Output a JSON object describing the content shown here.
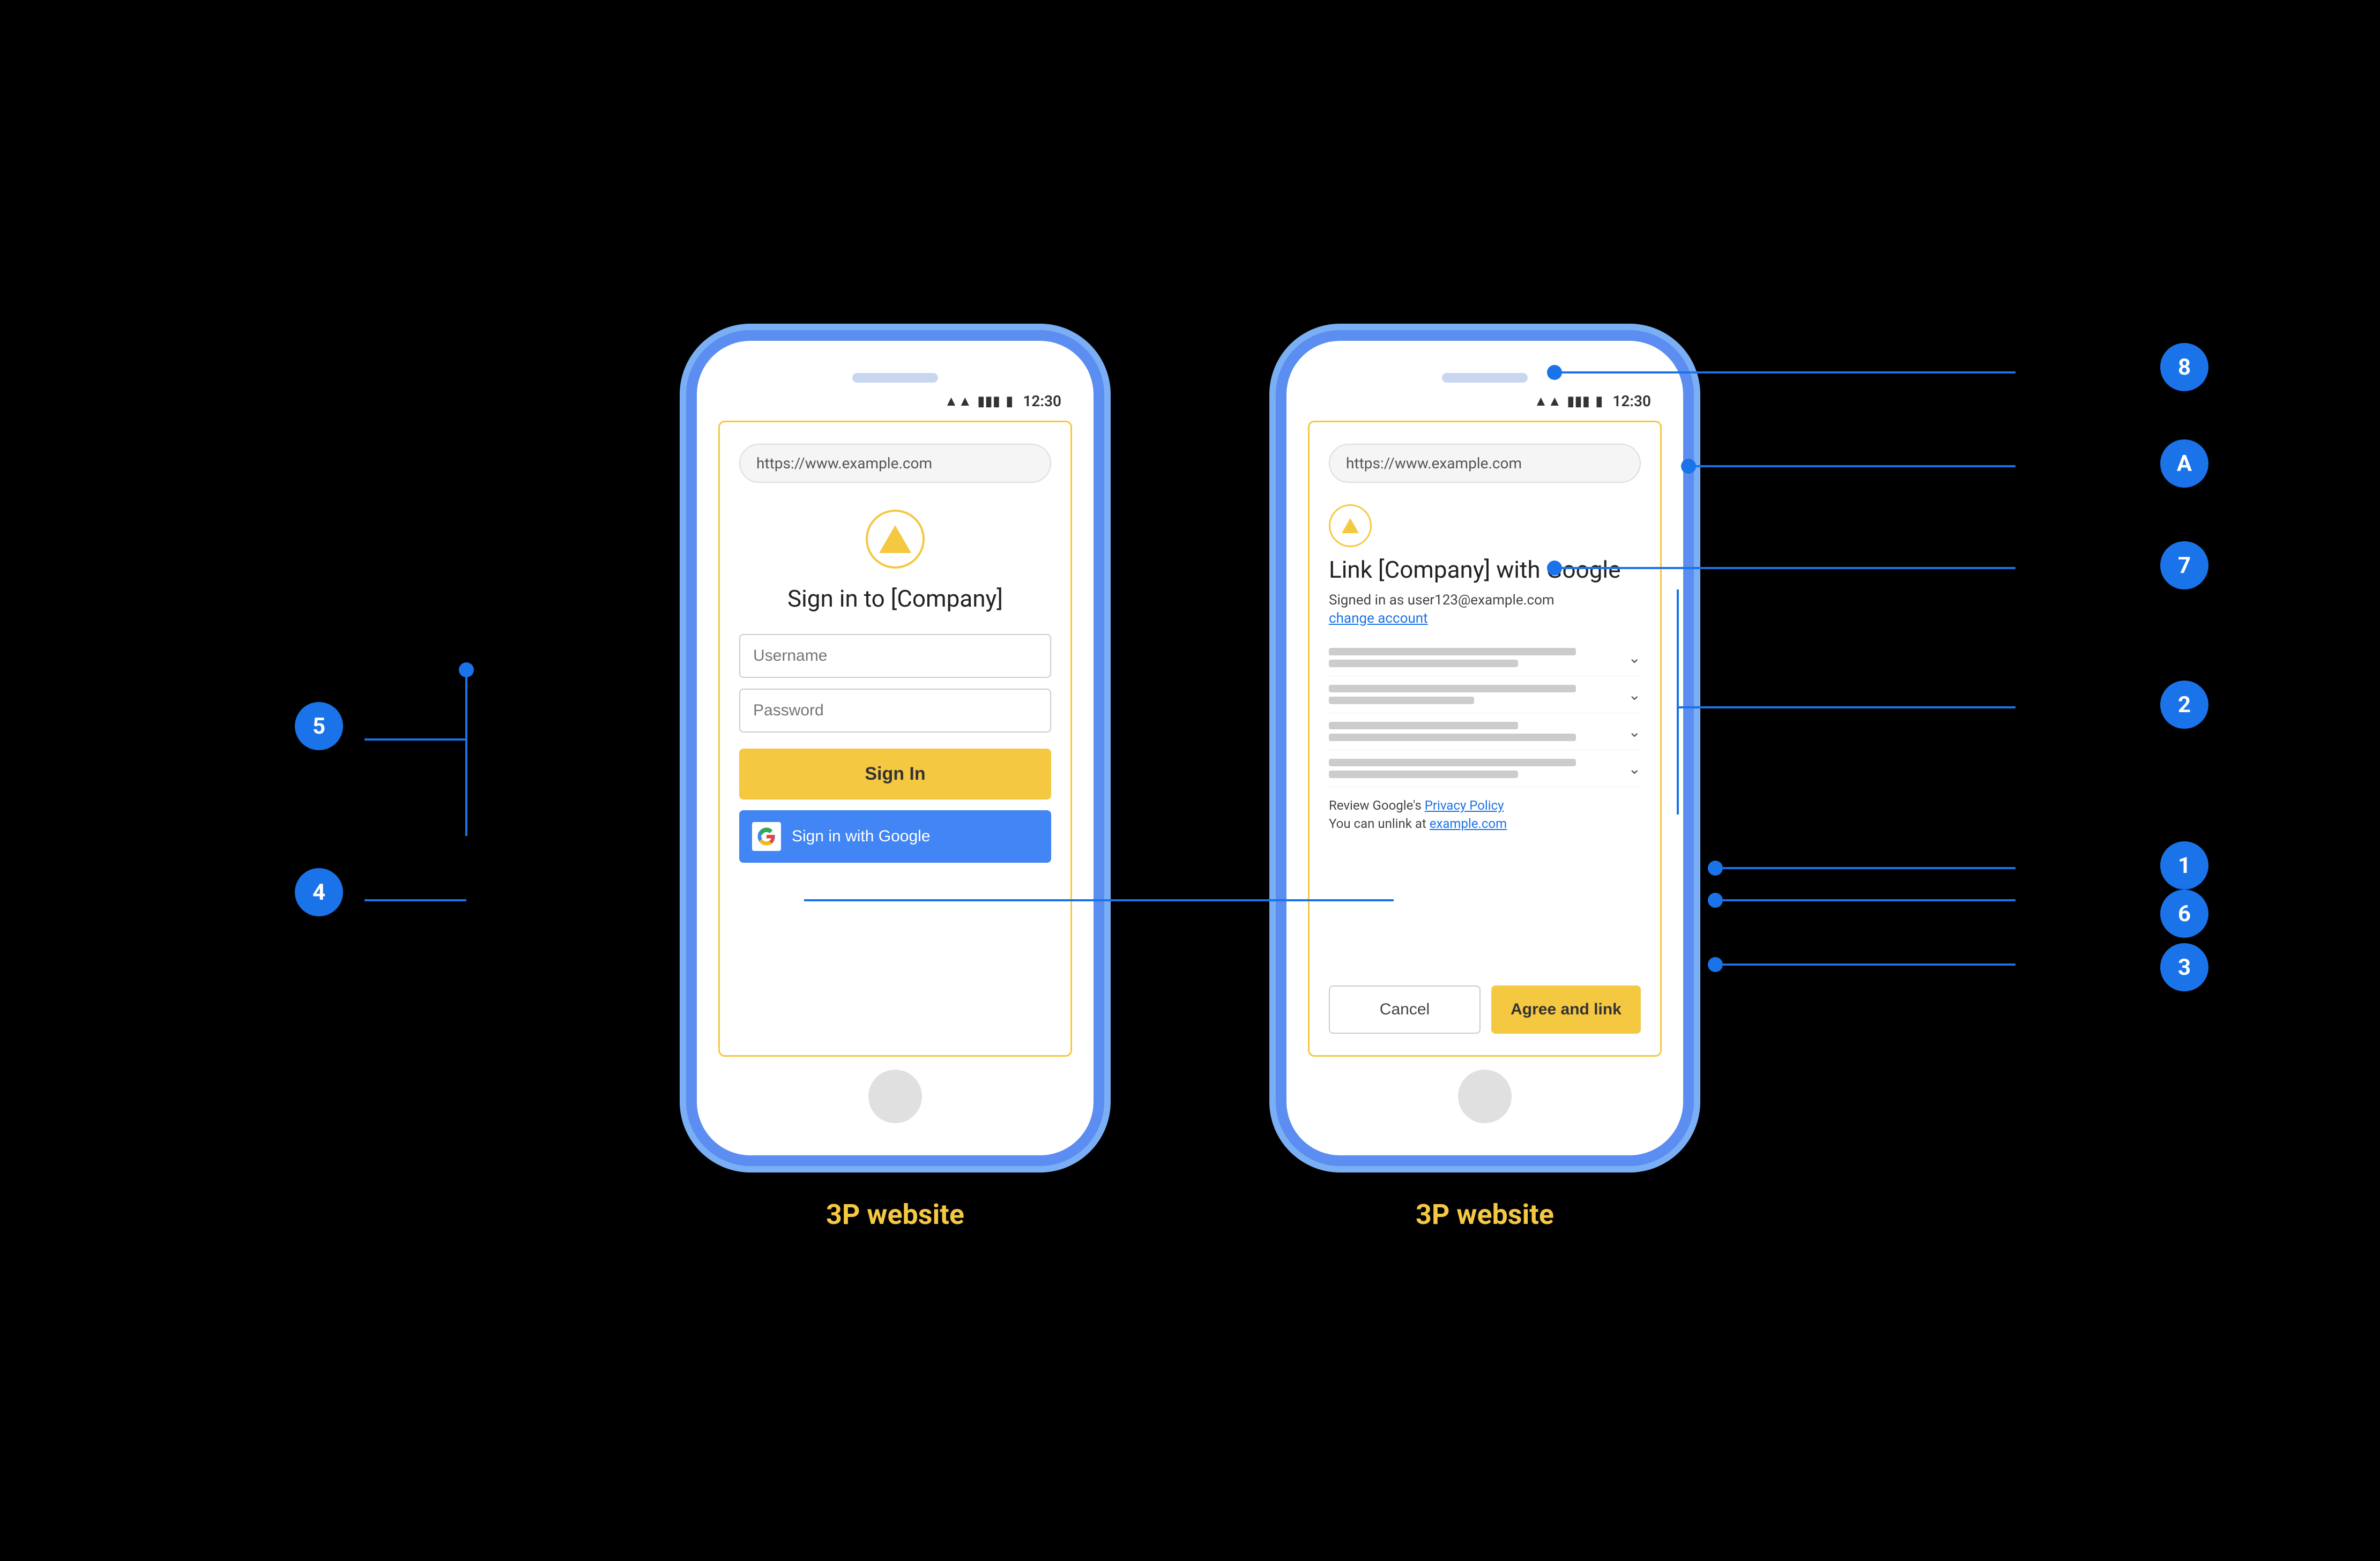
{
  "page": {
    "background": "#000000"
  },
  "phone1": {
    "label": "3P website",
    "status_bar": {
      "time": "12:30"
    },
    "url": "https://www.example.com",
    "sign_in_title": "Sign in to [Company]",
    "username_placeholder": "Username",
    "password_placeholder": "Password",
    "sign_in_button": "Sign In",
    "google_button": "Sign in with Google"
  },
  "phone2": {
    "label": "3P website",
    "status_bar": {
      "time": "12:30"
    },
    "url": "https://www.example.com",
    "link_title": "Link [Company] with Google",
    "signed_in_as": "Signed in as user123@example.com",
    "change_account": "change account",
    "policy_text": "Review Google's ",
    "policy_link": "Privacy Policy",
    "unlink_text": "You can unlink at ",
    "unlink_link": "example.com",
    "cancel_button": "Cancel",
    "agree_button": "Agree and link"
  },
  "badges": [
    {
      "id": "badge-1",
      "label": "1"
    },
    {
      "id": "badge-2",
      "label": "2"
    },
    {
      "id": "badge-3",
      "label": "3"
    },
    {
      "id": "badge-4",
      "label": "4"
    },
    {
      "id": "badge-5",
      "label": "5"
    },
    {
      "id": "badge-6",
      "label": "6"
    },
    {
      "id": "badge-7",
      "label": "7"
    },
    {
      "id": "badge-8",
      "label": "8"
    },
    {
      "id": "badge-A",
      "label": "A"
    }
  ]
}
